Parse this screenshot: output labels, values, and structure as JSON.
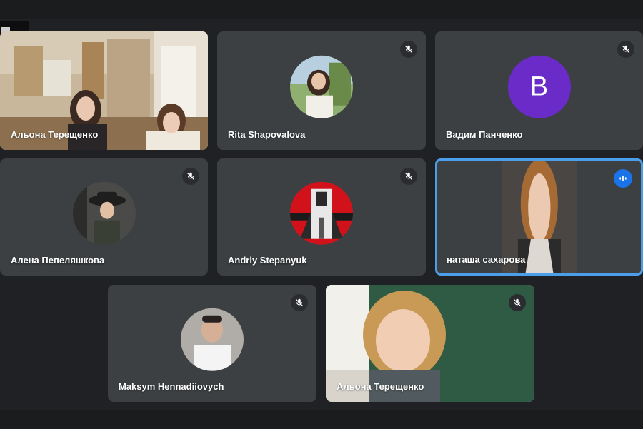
{
  "participants": [
    {
      "name": "Альона Терещенко",
      "muted": false,
      "video": "classroom"
    },
    {
      "name": "Rita Shapovalova",
      "muted": true,
      "avatar": "photo-outdoor"
    },
    {
      "name": "Вадим Панченко",
      "muted": true,
      "avatar_letter": "В",
      "avatar_color": "#6a2bc9"
    },
    {
      "name": "Алена Пепеляшкова",
      "muted": true,
      "avatar": "photo-hat"
    },
    {
      "name": "Andriy Stepanyuk",
      "muted": true,
      "avatar": "illustration-red"
    },
    {
      "name": "наташа сахарова",
      "muted": false,
      "speaking": true,
      "video": "webcam"
    },
    {
      "name": "Maksym Hennadiiovych",
      "muted": true,
      "avatar": "photo-portrait"
    },
    {
      "name": "Альона Терещенко",
      "muted": true,
      "video": "webcam-board"
    }
  ],
  "colors": {
    "background": "#202124",
    "tile": "#3c4043",
    "active_border": "#4b9eea",
    "speaking_badge": "#1a73e8"
  },
  "icons": {
    "mute": "mic-off-icon",
    "speaking": "audio-level-icon",
    "effects": "sun-icon"
  }
}
